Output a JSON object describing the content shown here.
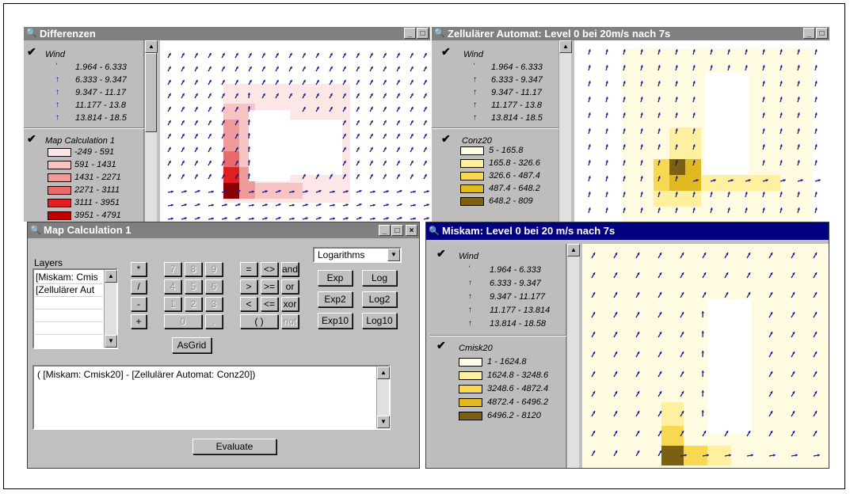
{
  "windows": {
    "differenzen": {
      "title": "Differenzen",
      "wind_title": "Wind",
      "wind_ranges": [
        "1.964 - 6.333",
        "6.333 - 9.347",
        "9.347 - 11.17",
        "11.177 - 13.8",
        "13.814 - 18.5"
      ],
      "calc_title": "Map Calculation 1",
      "calc_ranges": [
        "-249 - 591",
        "591 - 1431",
        "1431 - 2271",
        "2271 - 3111",
        "3111 - 3951",
        "3951 - 4791"
      ],
      "calc_colors": [
        "#fde6e6",
        "#f7c3c3",
        "#f09a9a",
        "#e86a6a",
        "#e02020",
        "#c00000"
      ]
    },
    "zellularer": {
      "title": "Zellulärer Automat: Level 0 bei 20m/s nach 7s",
      "wind_title": "Wind",
      "wind_ranges": [
        "1.964 - 6.333",
        "6.333 - 9.347",
        "9.347 - 11.17",
        "11.177 - 13.8",
        "13.814 - 18.5"
      ],
      "conz_title": "Conz20",
      "conz_ranges": [
        "5 - 165.8",
        "165.8 - 326.6",
        "326.6 - 487.4",
        "487.4 - 648.2",
        "648.2 - 809"
      ],
      "conz_colors": [
        "#fffbe0",
        "#fff0a0",
        "#f8d850",
        "#e0b820",
        "#7a6010"
      ]
    },
    "miskam": {
      "title": "Miskam: Level 0 bei 20 m/s nach 7s",
      "wind_title": "Wind",
      "wind_ranges": [
        "1.964 - 6.333",
        "6.333 - 9.347",
        "9.347 - 11.177",
        "11.177 - 13.814",
        "13.814 - 18.58"
      ],
      "cmisk_title": "Cmisk20",
      "cmisk_ranges": [
        "1 - 1624.8",
        "1624.8 - 3248.6",
        "3248.6 - 4872.4",
        "4872.4 - 6496.2",
        "6496.2 - 8120"
      ],
      "cmisk_colors": [
        "#fffbe0",
        "#fff0a0",
        "#f8d850",
        "#e0b820",
        "#7a6010"
      ]
    },
    "map_calc": {
      "title": "Map Calculation 1",
      "layers_label": "Layers",
      "layers": [
        "[Miskam: Cmis",
        "[Zellulärer Aut",
        "",
        "",
        ""
      ],
      "function_select": "Logarithms",
      "operators": [
        "*",
        "/",
        "-",
        "+"
      ],
      "keypad": [
        "7",
        "8",
        "9",
        "4",
        "5",
        "6",
        "1",
        "2",
        "3",
        "0",
        "."
      ],
      "logic": [
        "=",
        "<>",
        "and",
        ">",
        ">=",
        "or",
        "<",
        "<=",
        "xor",
        "( )",
        "not"
      ],
      "functions": [
        "Exp",
        "Log",
        "Exp2",
        "Log2",
        "Exp10",
        "Log10"
      ],
      "asgrid": "AsGrid",
      "expression": "( [Miskam: Cmisk20] - [Zellulärer Automat: Conz20])",
      "evaluate": "Evaluate"
    }
  }
}
